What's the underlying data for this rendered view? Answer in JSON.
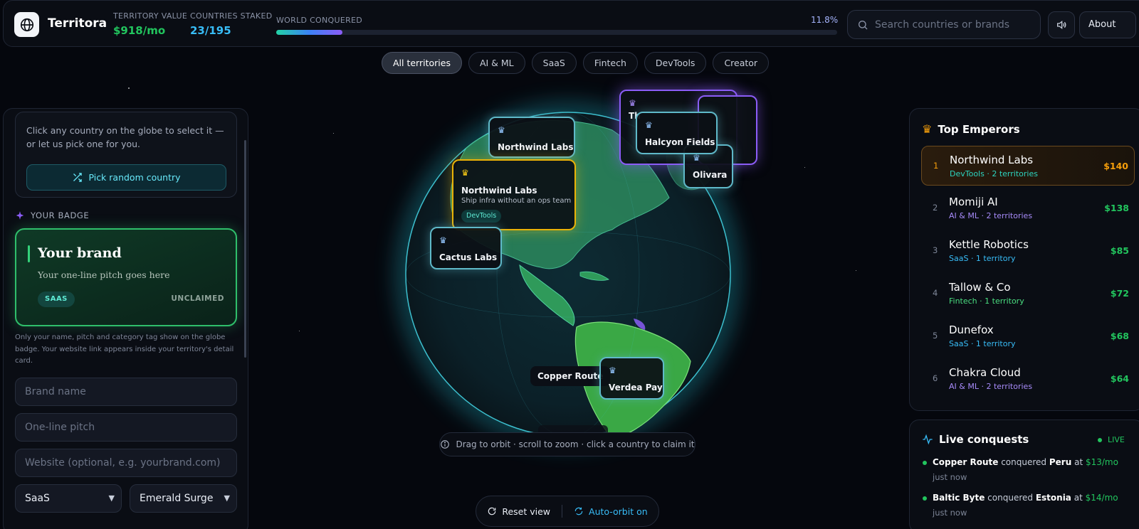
{
  "app": {
    "name": "Territora"
  },
  "stats": {
    "value_label": "TERRITORY VALUE",
    "value": "$918/mo",
    "staked_label": "COUNTRIES STAKED",
    "staked": "23/195",
    "conquered_label": "WORLD CONQUERED",
    "conquered_pct": "11.8%",
    "conquered_fraction": 0.118
  },
  "search": {
    "placeholder": "Search countries or brands"
  },
  "header": {
    "about_label": "About"
  },
  "filters": [
    "All territories",
    "AI & ML",
    "SaaS",
    "Fintech",
    "DevTools",
    "Creator"
  ],
  "left_panel": {
    "intro": "Click any country on the globe to select it — or let us pick one for you.",
    "pick_random_label": "Pick random country",
    "badge_section_title": "YOUR BADGE",
    "badge": {
      "name": "Your brand",
      "pitch": "Your one-line pitch goes here",
      "tag": "SAAS",
      "status": "UNCLAIMED"
    },
    "note": "Only your name, pitch and category tag show on the globe badge. Your website link appears inside your territory's detail card.",
    "form": {
      "brand_placeholder": "Brand name",
      "pitch_placeholder": "One-line pitch",
      "website_placeholder": "Website (optional, e.g. yourbrand.com)",
      "category_value": "SaaS",
      "theme_value": "Emerald Surge"
    }
  },
  "globe": {
    "badges": {
      "northwind_small": {
        "name": "Northwind Labs"
      },
      "northwind_big": {
        "name": "Northwind Labs",
        "pitch": "Ship infra without an ops team",
        "tag": "DevTools"
      },
      "cactus": {
        "name": "Cactus Labs"
      },
      "halcyon": {
        "name": "Halcyon Fields"
      },
      "olivara": {
        "name": "Olivara"
      },
      "verdea": {
        "name": "Verdea Pay"
      },
      "copper_route": {
        "name": "Copper Route"
      },
      "partial": {
        "name": "Th"
      }
    },
    "hint": "Drag to orbit · scroll to zoom · click a country to claim it"
  },
  "controls": {
    "reset_label": "Reset view",
    "autoorbit_label": "Auto-orbit on"
  },
  "top_emperors": {
    "title": "Top Emperors",
    "rows": [
      {
        "rank": "1",
        "name": "Northwind Labs",
        "sub": "DevTools · 2 territories",
        "amount": "$140",
        "color": "#2dd4bf",
        "amount_color": "#f59e0b"
      },
      {
        "rank": "2",
        "name": "Momiji AI",
        "sub": "AI & ML · 2 territories",
        "amount": "$138",
        "color": "#a78bfa",
        "amount_color": "#22c55e"
      },
      {
        "rank": "3",
        "name": "Kettle Robotics",
        "sub": "SaaS · 1 territory",
        "amount": "$85",
        "color": "#38bdf8",
        "amount_color": "#22c55e"
      },
      {
        "rank": "4",
        "name": "Tallow & Co",
        "sub": "Fintech · 1 territory",
        "amount": "$72",
        "color": "#4ade80",
        "amount_color": "#22c55e"
      },
      {
        "rank": "5",
        "name": "Dunefox",
        "sub": "SaaS · 1 territory",
        "amount": "$68",
        "color": "#38bdf8",
        "amount_color": "#22c55e"
      },
      {
        "rank": "6",
        "name": "Chakra Cloud",
        "sub": "AI & ML · 2 territories",
        "amount": "$64",
        "color": "#a78bfa",
        "amount_color": "#22c55e"
      }
    ]
  },
  "live_conquests": {
    "title": "Live conquests",
    "live_tag": "LIVE",
    "items": [
      {
        "brand": "Copper Route",
        "verb": "conquered",
        "country": "Peru",
        "at": "at",
        "amount": "$13/mo",
        "time": "just now"
      },
      {
        "brand": "Baltic Byte",
        "verb": "conquered",
        "country": "Estonia",
        "at": "at",
        "amount": "$14/mo",
        "time": "just now"
      }
    ]
  },
  "colors": {
    "accent": "#22d3ee",
    "green": "#22c55e",
    "gold": "#f59e0b",
    "purple": "#8b5cf6"
  }
}
